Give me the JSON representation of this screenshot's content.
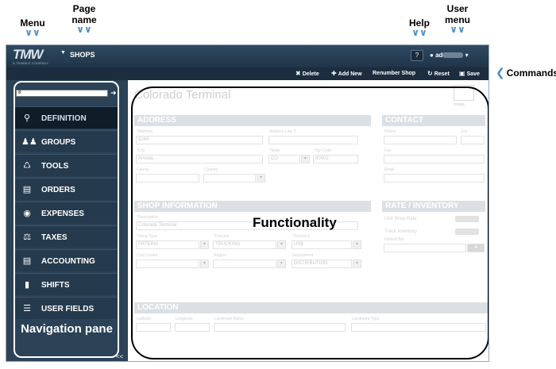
{
  "callouts": {
    "menu": "Menu",
    "page_name": "Page name",
    "help": "Help",
    "user_menu": "User menu",
    "commands": "Commands",
    "navigation_pane": "Navigation pane",
    "functionality": "Functionality"
  },
  "topbar": {
    "logo": "TMW",
    "logo_sub": "A TRIMBLE COMPANY",
    "page_title": "SHOPS",
    "help_label": "?",
    "user_prefix": "ad"
  },
  "commands": {
    "delete": "Delete",
    "add_new": "Add New",
    "renumber": "Renumber Shop",
    "reset": "Reset",
    "save": "Save"
  },
  "nav": {
    "search_value": "8",
    "collapse": "<<",
    "items": [
      {
        "label": "DEFINITION",
        "icon": "search-icon"
      },
      {
        "label": "GROUPS",
        "icon": "people-icon"
      },
      {
        "label": "TOOLS",
        "icon": "tools-icon"
      },
      {
        "label": "ORDERS",
        "icon": "document-icon"
      },
      {
        "label": "EXPENSES",
        "icon": "dollar-icon"
      },
      {
        "label": "TAXES",
        "icon": "scale-icon"
      },
      {
        "label": "ACCOUNTING",
        "icon": "accounting-icon"
      },
      {
        "label": "SHIFTS",
        "icon": "shift-icon"
      },
      {
        "label": "USER FIELDS",
        "icon": "list-icon"
      }
    ]
  },
  "main": {
    "record_title": "Colorado Terminal",
    "image_label": "Image",
    "sections": {
      "address": "ADDRESS",
      "contact": "CONTACT",
      "shop_info": "SHOP INFORMATION",
      "rate_inventory": "RATE / INVENTORY",
      "location": "LOCATION"
    },
    "address": {
      "address_label": "*Address",
      "address_value": "5265",
      "address2_label": "Address Line 2",
      "city_label": "*City",
      "city_value": "Arvada",
      "state_label": "*State",
      "state_value": "CO",
      "zip_label": "*Zip Code",
      "zip_value": "80002",
      "county_label": "County",
      "country_label": "Country"
    },
    "contact": {
      "phone_label": "Phone",
      "ext_label": "Ext",
      "fax_label": "Fax",
      "email_label": "Email"
    },
    "shop_info": {
      "description_label": "*Description",
      "description_value": "Colorado Terminal",
      "shop_type_label": "*Shop Type",
      "shop_type_value": "FRTERM",
      "division_label": "*Division",
      "division_value": "TRUCKING",
      "currency_label": "*Currency",
      "currency_value": "US$",
      "cost_center_label": "Cost Center",
      "region_label": "Region",
      "department_label": "Department",
      "department_value": "DISTRIBUTION"
    },
    "rate": {
      "use_shop_rate": "Use Shop Rate",
      "track_inventory": "Track Inventory",
      "default_bin": "Default Bin"
    },
    "location": {
      "latitude": "Latitude",
      "longitude": "Longitude",
      "landmark_name": "Landmark Name",
      "landmark_type": "Landmark Type"
    }
  }
}
